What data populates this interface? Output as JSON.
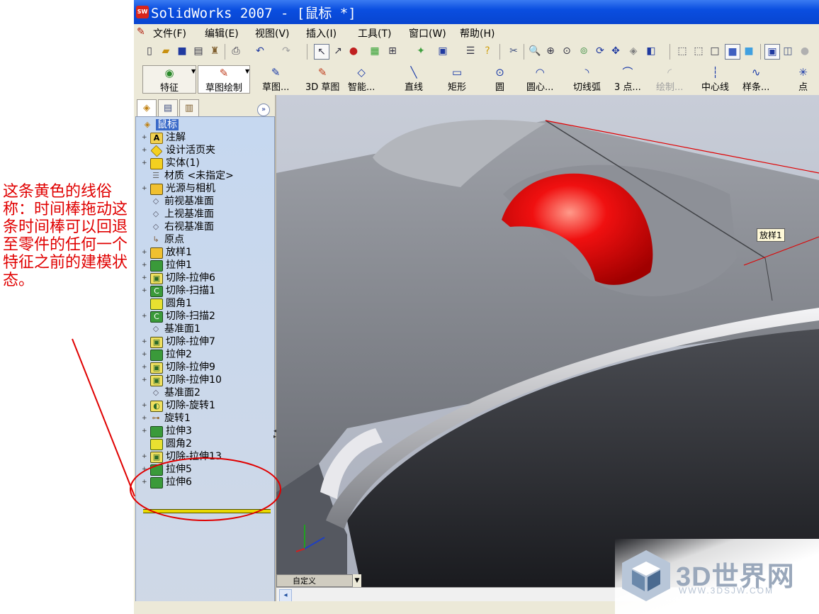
{
  "annotation": {
    "text": "这条黄色的线俗称：时间棒拖动这条时间棒可以回退至零件的任何一个特征之前的建模状态。",
    "color": "#e00000"
  },
  "window": {
    "title": "SolidWorks 2007 - [鼠标 *]",
    "app_icon": "SW"
  },
  "menu": [
    "文件(F)",
    "编辑(E)",
    "视图(V)",
    "插入(I)",
    "工具(T)",
    "窗口(W)",
    "帮助(H)"
  ],
  "toolbar": {
    "features_label": "特征",
    "sketch_draw_label": "草图绘制",
    "commands": [
      "草图...",
      "3D 草图",
      "智能...",
      "直线",
      "矩形",
      "圆",
      "圆心...",
      "切线弧",
      "3 点...",
      "绘制...",
      "中心线",
      "样条...",
      "点"
    ],
    "disabled_command": "绘制..."
  },
  "feature_tree": {
    "root": "鼠标",
    "items": [
      {
        "label": "注解",
        "expandable": true,
        "icon": "annotation-icon"
      },
      {
        "label": "设计活页夹",
        "expandable": true,
        "icon": "design-binder-icon"
      },
      {
        "label": "实体(1)",
        "expandable": true,
        "icon": "solid-body-icon"
      },
      {
        "label": "材质 <未指定>",
        "expandable": false,
        "icon": "material-icon"
      },
      {
        "label": "光源与相机",
        "expandable": true,
        "icon": "lights-camera-icon"
      },
      {
        "label": "前视基准面",
        "expandable": false,
        "icon": "plane-icon"
      },
      {
        "label": "上视基准面",
        "expandable": false,
        "icon": "plane-icon"
      },
      {
        "label": "右视基准面",
        "expandable": false,
        "icon": "plane-icon"
      },
      {
        "label": "原点",
        "expandable": false,
        "icon": "origin-icon"
      },
      {
        "label": "放样1",
        "expandable": true,
        "icon": "loft-icon"
      },
      {
        "label": "拉伸1",
        "expandable": true,
        "icon": "extrude-icon"
      },
      {
        "label": "切除-拉伸6",
        "expandable": true,
        "icon": "cut-extrude-icon"
      },
      {
        "label": "切除-扫描1",
        "expandable": true,
        "icon": "cut-sweep-icon"
      },
      {
        "label": "圆角1",
        "expandable": false,
        "icon": "fillet-icon"
      },
      {
        "label": "切除-扫描2",
        "expandable": true,
        "icon": "cut-sweep-icon"
      },
      {
        "label": "基准面1",
        "expandable": false,
        "icon": "plane-icon"
      },
      {
        "label": "切除-拉伸7",
        "expandable": true,
        "icon": "cut-extrude-icon"
      },
      {
        "label": "拉伸2",
        "expandable": true,
        "icon": "extrude-icon"
      },
      {
        "label": "切除-拉伸9",
        "expandable": true,
        "icon": "cut-extrude-icon"
      },
      {
        "label": "切除-拉伸10",
        "expandable": true,
        "icon": "cut-extrude-icon"
      },
      {
        "label": "基准面2",
        "expandable": false,
        "icon": "plane-icon"
      },
      {
        "label": "切除-旋转1",
        "expandable": true,
        "icon": "cut-revolve-icon"
      },
      {
        "label": "旋转1",
        "expandable": true,
        "icon": "revolve-icon"
      },
      {
        "label": "拉伸3",
        "expandable": true,
        "icon": "extrude-icon"
      },
      {
        "label": "圆角2",
        "expandable": false,
        "icon": "fillet-icon"
      },
      {
        "label": "切除-拉伸13",
        "expandable": true,
        "icon": "cut-extrude-icon"
      },
      {
        "label": "拉伸5",
        "expandable": true,
        "icon": "extrude-icon"
      },
      {
        "label": "拉伸6",
        "expandable": true,
        "icon": "extrude-icon"
      }
    ],
    "rollback_bar_color": "#e8d800"
  },
  "viewport": {
    "tag_label": "放样1",
    "view_combo": "自定义",
    "model_highlight_color": "#e00000"
  },
  "watermark": {
    "text": "3D世界网",
    "url": "WWW.3DSJW.COM"
  }
}
